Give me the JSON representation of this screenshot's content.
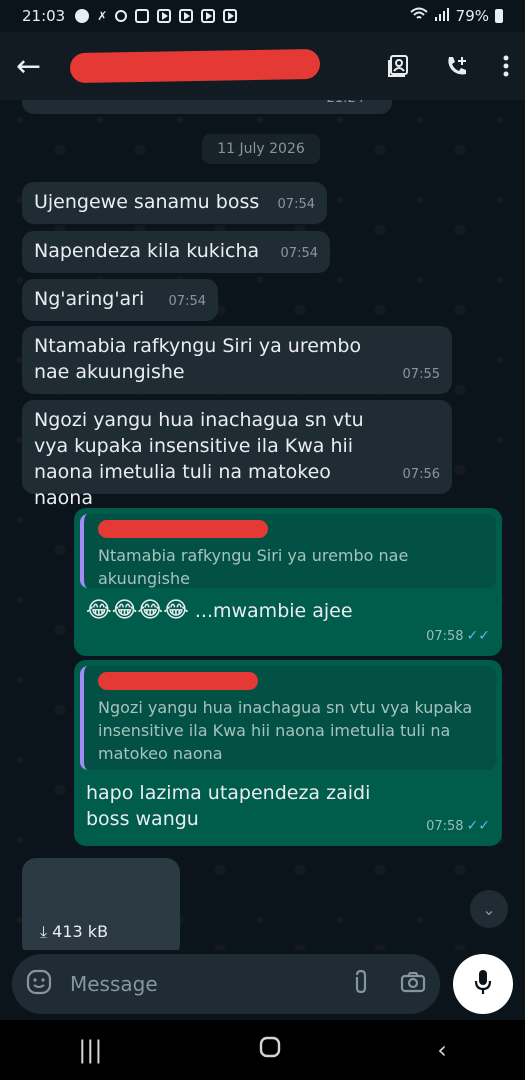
{
  "status_bar": {
    "time": "21:03",
    "battery": "79%"
  },
  "header": {
    "contact_name_redacted": true
  },
  "chat": {
    "partial_time": "21:24",
    "date_chip": "11 July 2026",
    "messages": [
      {
        "text": "Ujengewe sanamu boss",
        "time": "07:54"
      },
      {
        "text": "Napendeza kila kukicha",
        "time": "07:54"
      },
      {
        "text": "Ng'aring'ari",
        "time": "07:54"
      },
      {
        "text": "Ntamabia rafkyngu Siri ya urembo nae akuungishe",
        "time": "07:55"
      },
      {
        "text": "Ngozi yangu hua inachagua sn vtu vya kupaka insensitive ila Kwa hii naona imetulia tuli na matokeo naona",
        "time": "07:56"
      }
    ],
    "outgoing": [
      {
        "quote": "Ntamabia rafkyngu Siri ya urembo nae akuungishe",
        "emojis": "😂😂😂😂",
        "text": "...mwambie ajee",
        "time": "07:58"
      },
      {
        "quote": "Ngozi yangu hua inachagua sn vtu vya kupaka insensitive ila Kwa hii naona imetulia tuli na matokeo naona",
        "text": "hapo lazima utapendeza zaidi boss wangu",
        "time": "07:58"
      }
    ],
    "media_size": "413 kB"
  },
  "input": {
    "placeholder": "Message"
  },
  "colors": {
    "background": "#0b141a",
    "incoming_bubble": "#202c33",
    "outgoing_bubble": "#005c4b",
    "read_ticks": "#53bdeb"
  }
}
